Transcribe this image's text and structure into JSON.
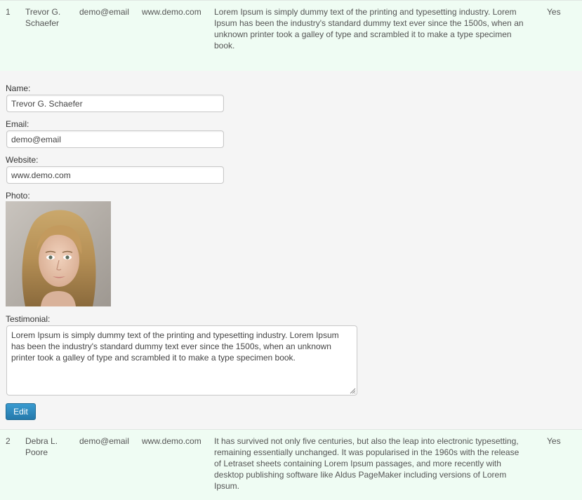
{
  "rows": [
    {
      "number": "1",
      "name": "Trevor G. Schaefer",
      "email": "demo@email",
      "website": "www.demo.com",
      "testimonial": "Lorem Ipsum is simply dummy text of the printing and typesetting industry. Lorem Ipsum has been the industry's standard dummy text ever since the 1500s, when an unknown printer took a galley of type and scrambled it to make a type specimen book.",
      "approved": "Yes"
    },
    {
      "number": "2",
      "name": "Debra L. Poore",
      "email": "demo@email",
      "website": "www.demo.com",
      "testimonial": "It has survived not only five centuries, but also the leap into electronic typesetting, remaining essentially unchanged. It was popularised in the 1960s with the release of Letraset sheets containing Lorem Ipsum passages, and more recently with desktop publishing software like Aldus PageMaker including versions of Lorem Ipsum.",
      "approved": "Yes"
    }
  ],
  "detail": {
    "name_label": "Name:",
    "name_value": "Trevor G. Schaefer",
    "email_label": "Email:",
    "email_value": "demo@email",
    "website_label": "Website:",
    "website_value": "www.demo.com",
    "photo_label": "Photo:",
    "testimonial_label": "Testimonial:",
    "testimonial_value": "Lorem Ipsum is simply dummy text of the printing and typesetting industry. Lorem Ipsum has been the industry's standard dummy text ever since the 1500s, when an unknown printer took a galley of type and scrambled it to make a type specimen book.",
    "edit_label": "Edit"
  },
  "colors": {
    "row_background": "#effcf3",
    "panel_background": "#f5f5f5",
    "button_blue": "#2a87bd"
  },
  "icons": {
    "photo": "person-photo",
    "textarea_grip": "resize-grip-icon"
  }
}
